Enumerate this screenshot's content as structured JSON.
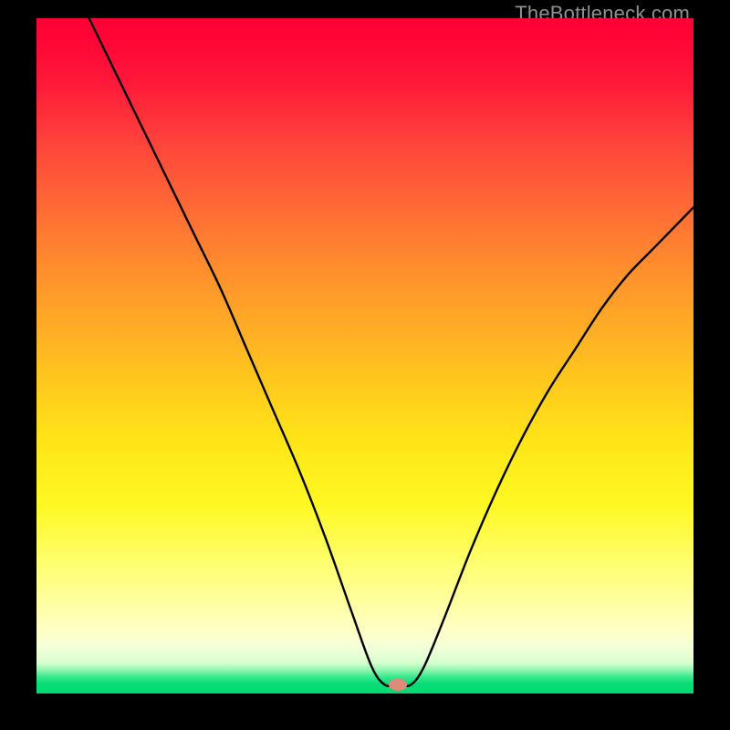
{
  "watermark": "TheBottleneck.com",
  "chart_data": {
    "type": "line",
    "title": "",
    "xlabel": "",
    "ylabel": "",
    "xlim": [
      0,
      100
    ],
    "ylim": [
      0,
      100
    ],
    "grid": false,
    "legend": false,
    "notes": "Single black curve on a vertical rainbow gradient background with a thin green band near the bottom. No axes, ticks, or labels are shown; the outer margins are black. Curve resembles a V with both arms curving outward; the minimum touches the green band at roughly x≈55 where a small salmon-colored dot sits.",
    "gradient_background": {
      "stops": [
        {
          "pos": 0.0,
          "color": "#ff0033"
        },
        {
          "pos": 0.05,
          "color": "#ff0a37"
        },
        {
          "pos": 0.1,
          "color": "#ff1b3a"
        },
        {
          "pos": 0.2,
          "color": "#ff4a3b"
        },
        {
          "pos": 0.28,
          "color": "#ff6a35"
        },
        {
          "pos": 0.36,
          "color": "#ff8a2e"
        },
        {
          "pos": 0.44,
          "color": "#ffa627"
        },
        {
          "pos": 0.52,
          "color": "#ffc21f"
        },
        {
          "pos": 0.62,
          "color": "#ffe318"
        },
        {
          "pos": 0.72,
          "color": "#fff823"
        },
        {
          "pos": 0.82,
          "color": "#ffff7a"
        },
        {
          "pos": 0.9,
          "color": "#ffffc0"
        },
        {
          "pos": 0.93,
          "color": "#f5ffd8"
        },
        {
          "pos": 0.955,
          "color": "#d6ffd0"
        },
        {
          "pos": 0.965,
          "color": "#90f7b0"
        },
        {
          "pos": 0.975,
          "color": "#3ae98d"
        },
        {
          "pos": 0.985,
          "color": "#08dd78"
        },
        {
          "pos": 1.0,
          "color": "#00d970"
        }
      ]
    },
    "series": [
      {
        "name": "curve",
        "color": "#000000",
        "points": [
          {
            "x": 8,
            "y": 100
          },
          {
            "x": 12,
            "y": 92
          },
          {
            "x": 16,
            "y": 84
          },
          {
            "x": 20,
            "y": 76
          },
          {
            "x": 24,
            "y": 68
          },
          {
            "x": 28,
            "y": 60
          },
          {
            "x": 32,
            "y": 51
          },
          {
            "x": 36,
            "y": 42
          },
          {
            "x": 40,
            "y": 33
          },
          {
            "x": 44,
            "y": 23
          },
          {
            "x": 48,
            "y": 12
          },
          {
            "x": 51,
            "y": 4
          },
          {
            "x": 53,
            "y": 1.3
          },
          {
            "x": 55,
            "y": 1.3
          },
          {
            "x": 57,
            "y": 1.3
          },
          {
            "x": 59,
            "y": 4
          },
          {
            "x": 62,
            "y": 11
          },
          {
            "x": 66,
            "y": 21
          },
          {
            "x": 70,
            "y": 30
          },
          {
            "x": 74,
            "y": 38
          },
          {
            "x": 78,
            "y": 45
          },
          {
            "x": 82,
            "y": 51
          },
          {
            "x": 86,
            "y": 57
          },
          {
            "x": 90,
            "y": 62
          },
          {
            "x": 94,
            "y": 66
          },
          {
            "x": 98,
            "y": 70
          },
          {
            "x": 100,
            "y": 72
          }
        ]
      }
    ],
    "marker": {
      "x": 55,
      "y": 1.3,
      "rx": 1.4,
      "ry": 0.9,
      "color": "#e08a7a"
    }
  }
}
